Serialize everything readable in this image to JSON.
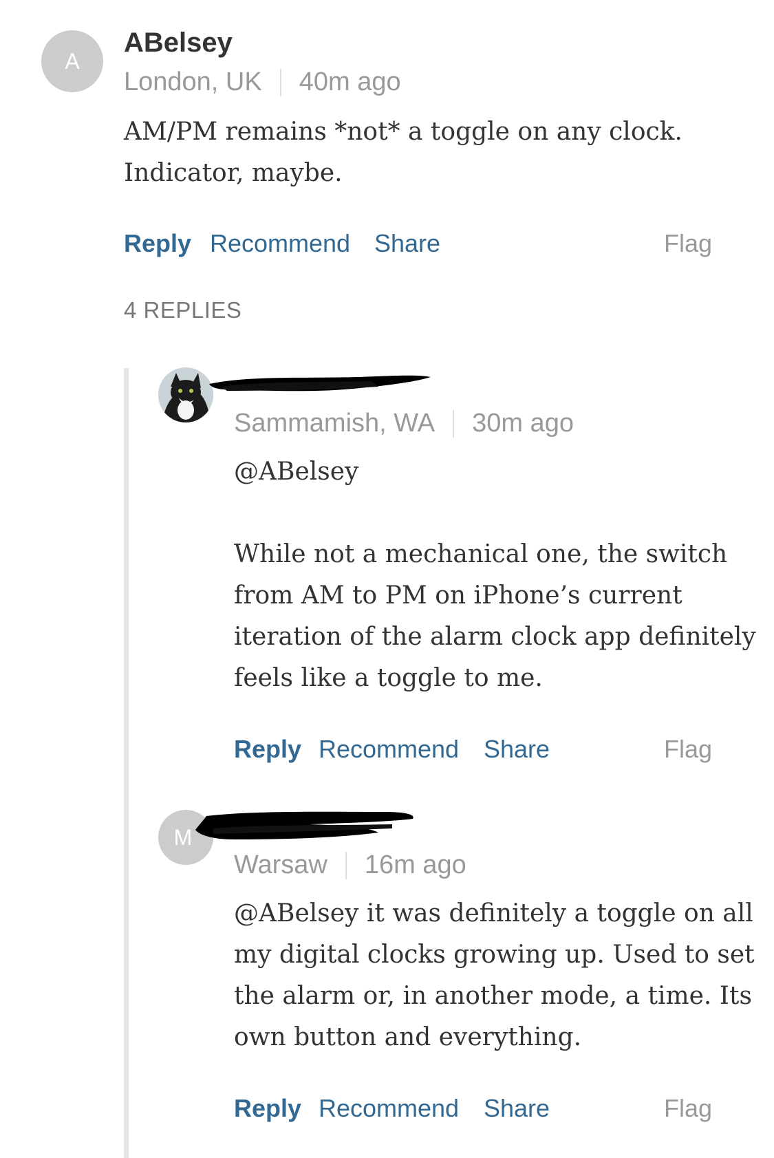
{
  "comments": [
    {
      "avatar_letter": "A",
      "author": "ABelsey",
      "location": "London, UK",
      "time": "40m ago",
      "text": "AM/PM remains *not* a toggle on any clock.\nIndicator, maybe.",
      "actions": {
        "reply": "Reply",
        "recommend": "Recommend",
        "share": "Share",
        "flag": "Flag"
      }
    }
  ],
  "replies_label": "4 REPLIES",
  "replies": [
    {
      "avatar_icon": "cat-photo-avatar",
      "location": "Sammamish, WA",
      "time": "30m ago",
      "text": "@ABelsey\n\nWhile not a mechanical one, the switch\nfrom AM to PM on iPhone’s current\niteration of the alarm clock app definitely\nfeels like a toggle to me.",
      "actions": {
        "reply": "Reply",
        "recommend": "Recommend",
        "share": "Share",
        "flag": "Flag"
      }
    },
    {
      "avatar_letter": "M",
      "location": "Warsaw",
      "time": "16m ago",
      "text": "@ABelsey it was definitely a toggle on all\nmy digital clocks growing up. Used to set\nthe alarm or, in another mode, a time. Its\nown button and everything.",
      "actions": {
        "reply": "Reply",
        "recommend": "Recommend",
        "share": "Share",
        "flag": "Flag"
      }
    }
  ],
  "colors": {
    "link": "#326891",
    "muted": "#999999",
    "text": "#333333",
    "avatar_bg": "#cccccc",
    "redaction": "#000000"
  }
}
